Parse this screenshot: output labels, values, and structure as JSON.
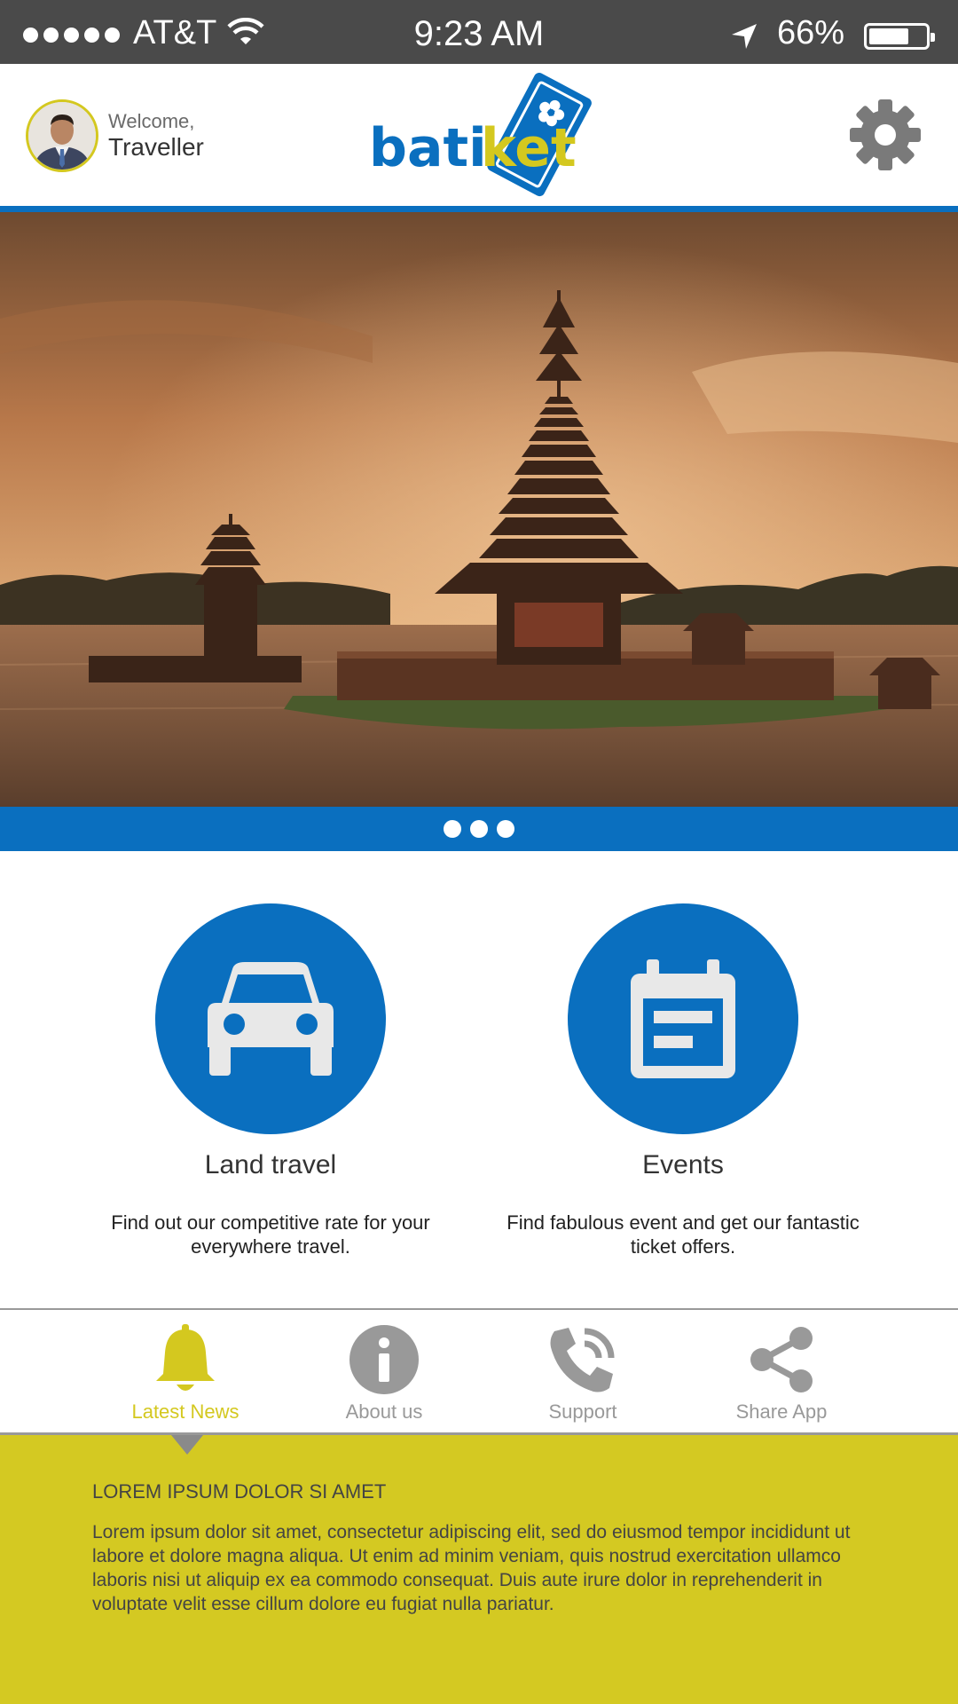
{
  "status_bar": {
    "carrier": "AT&T",
    "time": "9:23 AM",
    "battery": "66%",
    "signal_icon": "signal-dots-icon",
    "wifi_icon": "wifi-icon",
    "location_icon": "location-arrow-icon",
    "battery_icon": "battery-icon"
  },
  "header": {
    "welcome": "Welcome,",
    "username": "Traveller",
    "logo_text": "batiket",
    "settings_icon": "gear-icon"
  },
  "carousel": {
    "dots": 3
  },
  "features": [
    {
      "title": "Land travel",
      "description": "Find out our competitive rate for your everywhere travel.",
      "icon": "car-icon"
    },
    {
      "title": "Events",
      "description": "Find fabulous event and get our fantastic ticket offers.",
      "icon": "calendar-icon"
    }
  ],
  "tabs": [
    {
      "label": "Latest News",
      "icon": "bell-icon",
      "active": true
    },
    {
      "label": "About us",
      "icon": "info-icon",
      "active": false
    },
    {
      "label": "Support",
      "icon": "phone-icon",
      "active": false
    },
    {
      "label": "Share App",
      "icon": "share-icon",
      "active": false
    }
  ],
  "news": {
    "title": "LOREM IPSUM DOLOR SI AMET",
    "body": "Lorem ipsum dolor sit amet, consectetur adipiscing elit, sed do eiusmod tempor incididunt ut labore et dolore magna aliqua. Ut enim ad minim veniam, quis nostrud exercitation ullamco laboris nisi ut aliquip ex ea commodo consequat. Duis aute irure dolor in reprehenderit in voluptate velit esse cillum dolore eu fugiat nulla pariatur."
  },
  "colors": {
    "brand_blue": "#0a6fbf",
    "accent_yellow": "#d4c922",
    "status_bar": "#4a4a4a"
  }
}
